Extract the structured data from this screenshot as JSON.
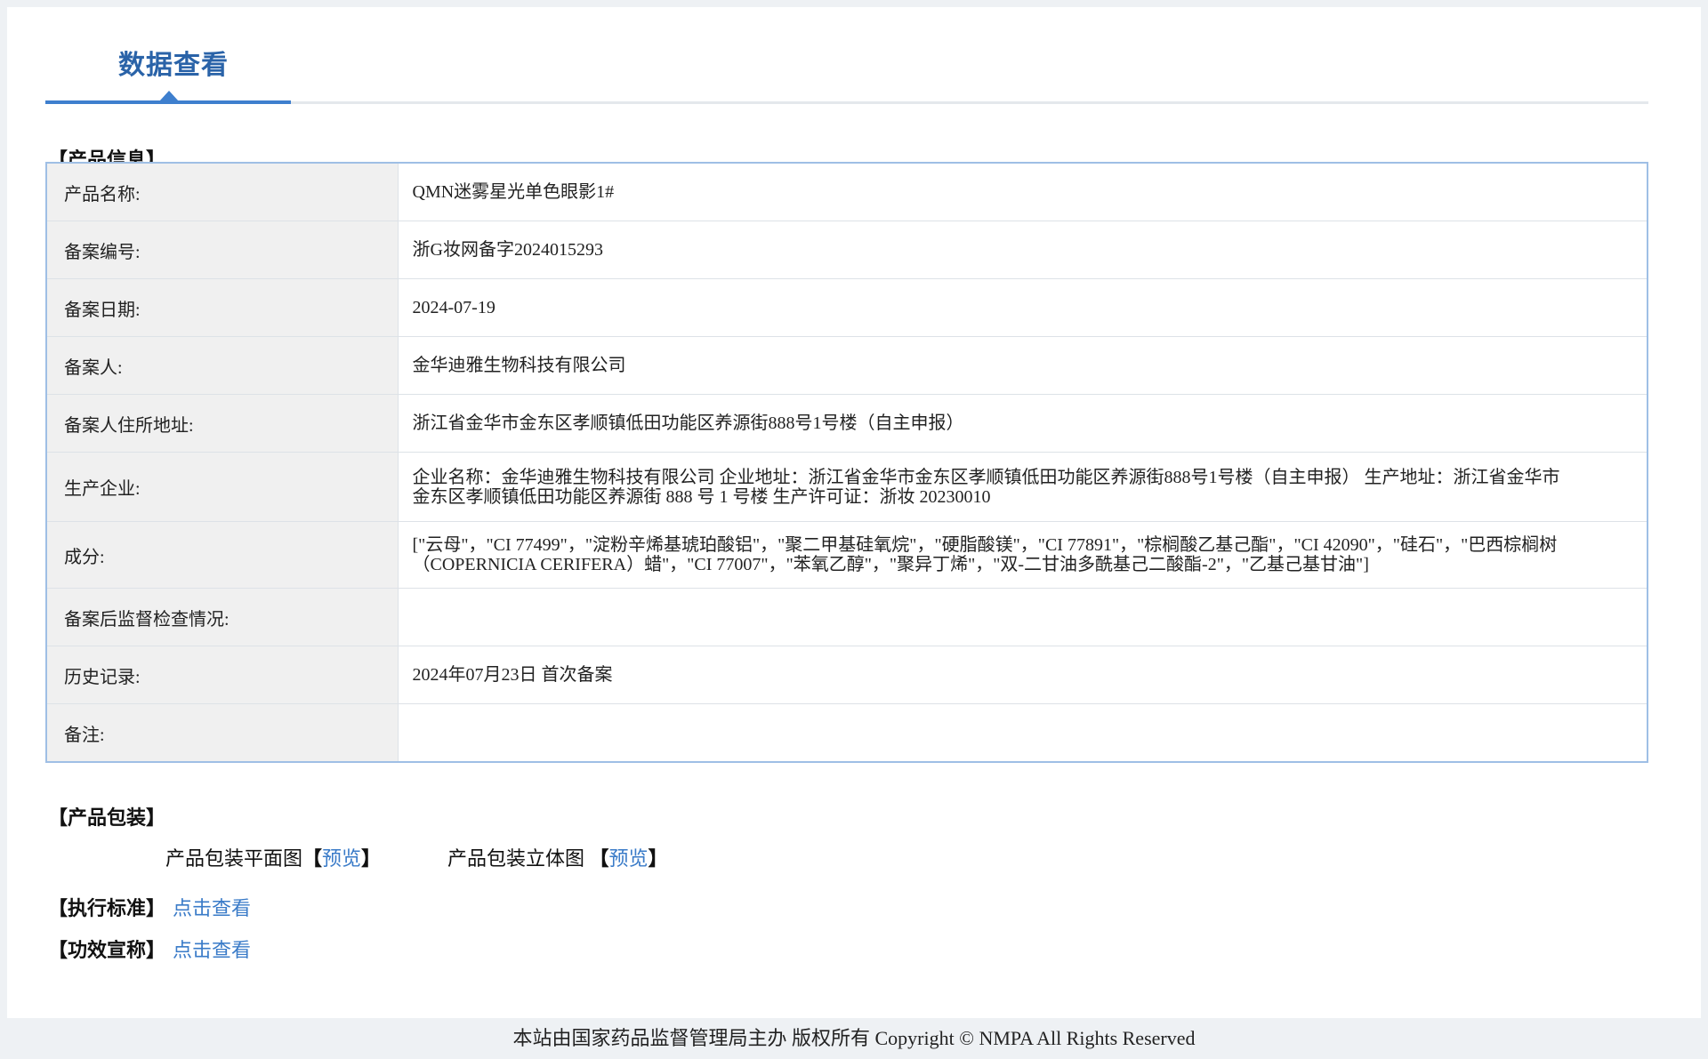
{
  "tab": {
    "title": "数据查看"
  },
  "product_info": {
    "heading": "【产品信息】",
    "rows": [
      {
        "label": "产品名称:",
        "value": "QMN迷雾星光单色眼影1#"
      },
      {
        "label": "备案编号:",
        "value": "浙G妆网备字2024015293"
      },
      {
        "label": "备案日期:",
        "value": "2024-07-19"
      },
      {
        "label": "备案人:",
        "value": "金华迪雅生物科技有限公司"
      },
      {
        "label": "备案人住所地址:",
        "value": "浙江省金华市金东区孝顺镇低田功能区养源街888号1号楼（自主申报）"
      },
      {
        "label": "生产企业:",
        "value": "企业名称：金华迪雅生物科技有限公司 企业地址：浙江省金华市金东区孝顺镇低田功能区养源街888号1号楼（自主申报） 生产地址：浙江省金华市金东区孝顺镇低田功能区养源街 888 号 1 号楼 生产许可证：浙妆 20230010"
      },
      {
        "label": "成分:",
        "value": "[\"云母\"，\"CI 77499\"，\"淀粉辛烯基琥珀酸铝\"，\"聚二甲基硅氧烷\"，\"硬脂酸镁\"，\"CI 77891\"，\"棕榈酸乙基己酯\"，\"CI 42090\"，\"硅石\"，\"巴西棕榈树（COPERNICIA CERIFERA）蜡\"，\"CI 77007\"，\"苯氧乙醇\"，\"聚异丁烯\"，\"双-二甘油多酰基己二酸酯-2\"，\"乙基己基甘油\"]"
      },
      {
        "label": "备案后监督检查情况:",
        "value": ""
      },
      {
        "label": "历史记录:",
        "value": "2024年07月23日 首次备案"
      },
      {
        "label": "备注:",
        "value": ""
      }
    ]
  },
  "packaging": {
    "heading": "【产品包装】",
    "flat_label": "产品包装平面图",
    "flat_link": "预览",
    "stereo_label": "产品包装立体图",
    "stereo_link": "预览",
    "bracket_open": "【",
    "bracket_close": "】"
  },
  "standard": {
    "heading": "【执行标准】",
    "link": "点击查看"
  },
  "efficacy": {
    "heading": "【功效宣称】",
    "link": "点击查看"
  },
  "footer": {
    "text": "本站由国家药品监督管理局主办 版权所有 Copyright © NMPA All Rights Reserved"
  }
}
